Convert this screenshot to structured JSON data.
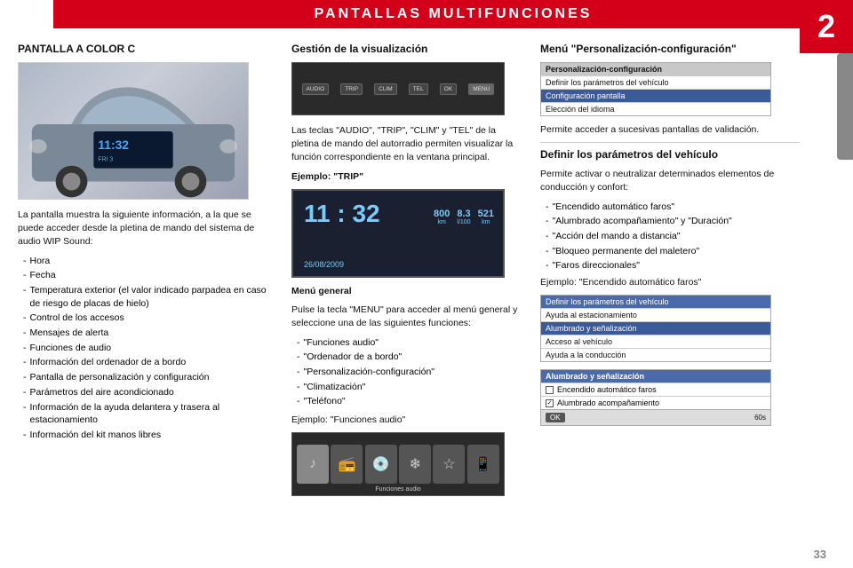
{
  "header": {
    "title": "PANTALLAS  MULTIFUNCIONES",
    "chapter": "2"
  },
  "col1": {
    "section_title": "PANTALLA A COLOR C",
    "body_intro": "La pantalla muestra la siguiente información, a la que se puede acceder desde la pletina de mando del sistema de audio WIP Sound:",
    "list_items": [
      "Hora",
      "Fecha",
      "Temperatura exterior (el valor indicado parpadea en caso de riesgo de placas de hielo)",
      "Control de los accesos",
      "Mensajes de alerta",
      "Funciones de audio",
      "Información del ordenador de a bordo",
      "Pantalla de personalización y configuración",
      "Parámetros del aire acondicionado",
      "Información de la ayuda delantera y trasera al estacionamiento",
      "Información del kit manos libres"
    ],
    "dashboard": {
      "time": "11:32",
      "sub": "FRI 3"
    }
  },
  "col2": {
    "section_title": "Gestión de la visualización",
    "body1": "Las teclas \"AUDIO\", \"TRIP\", \"CLIM\" y \"TEL\" de la pletina de mando del autorradio permiten visualizar la función correspondiente en la ventana principal.",
    "example1": "Ejemplo: \"TRIP\"",
    "trip_time": "11 : 32",
    "trip_date": "26/08/2009",
    "trip_stats": [
      {
        "value": "800",
        "label": "km"
      },
      {
        "value": "8.3",
        "label": "l/100"
      },
      {
        "value": "521",
        "label": "km"
      }
    ],
    "menu_title": "Menú general",
    "menu_body": "Pulse la tecla \"MENU\" para acceder al menú general y seleccione una de las siguientes funciones:",
    "menu_items": [
      "\"Funciones audio\"",
      "\"Ordenador de a bordo\"",
      "\"Personalización-configuración\"",
      "\"Climatización\"",
      "\"Teléfono\""
    ],
    "example2": "Ejemplo: \"Funciones audio\"",
    "funciones_label": "Funciones audio",
    "ctrl_buttons": [
      "AUDIO",
      "TRIP",
      "CLIM",
      "TEL",
      "OK",
      "MENU"
    ]
  },
  "col3": {
    "section_title1": "Menú \"Personalización-configuración\"",
    "config_header": "Personalización-configuración",
    "config_rows": [
      {
        "label": "Definir los parámetros del vehículo",
        "selected": false
      },
      {
        "label": "Configuración pantalla",
        "selected": true
      },
      {
        "label": "Elección del idioma",
        "selected": false
      }
    ],
    "body2": "Permite acceder a sucesivas pantallas de validación.",
    "section_title2": "Definir los parámetros del vehículo",
    "body3": "Permite activar o neutralizar determinados elementos de conducción y confort:",
    "define_list": [
      "\"Encendido automático faros\"",
      "\"Alumbrado acompañamiento\" y \"Duración\"",
      "\"Acción del mando a distancia\"",
      "\"Bloqueo permanente del maletero\"",
      "\"Faros direccionales\""
    ],
    "example3": "Ejemplo: \"Encendido automático faros\"",
    "define_box_header": "Definir los parámetros del vehículo",
    "define_box_rows": [
      {
        "label": "Ayuda al estacionamiento",
        "selected": false
      },
      {
        "label": "Alumbrado y señalización",
        "selected": true
      },
      {
        "label": "Acceso al vehículo",
        "selected": false
      },
      {
        "label": "Ayuda a la conducción",
        "selected": false
      }
    ],
    "alumbrado_header": "Alumbrado y señalización",
    "alumbrado_rows": [
      {
        "label": "Encendido automático faros",
        "checked": false
      },
      {
        "label": "Alumbrado acompañamiento",
        "checked": true
      }
    ],
    "ok_label": "OK",
    "time_label": "60s"
  },
  "page_number": "33"
}
